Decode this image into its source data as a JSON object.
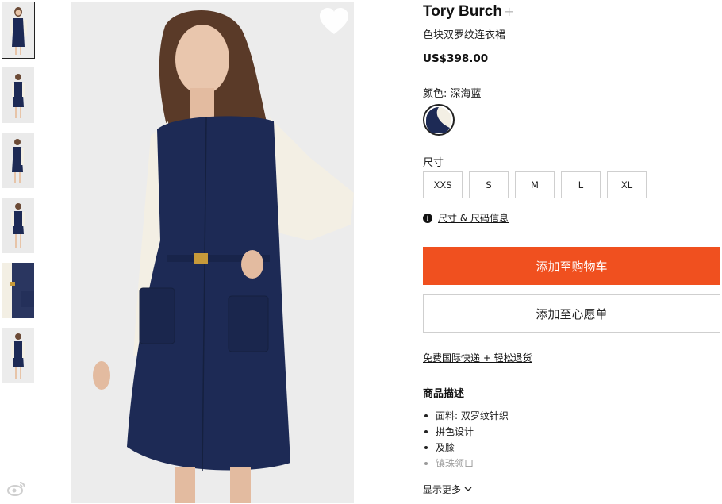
{
  "product": {
    "brand": "Tory Burch",
    "brand_plus": "+",
    "name": "色块双罗纹连衣裙",
    "price": "US$398.00"
  },
  "color": {
    "label": "颜色: 深海蓝",
    "swatch_colors": [
      "#1d2a55",
      "#f3efe4"
    ]
  },
  "size": {
    "label": "尺寸",
    "options": [
      "XXS",
      "S",
      "M",
      "L",
      "XL"
    ],
    "info_link": "尺寸 & 尺码信息"
  },
  "actions": {
    "add_to_cart": "添加至购物车",
    "add_to_wishlist": "添加至心愿单",
    "shipping": "免费国际快递 + 轻松退货"
  },
  "description": {
    "title": "商品描述",
    "bullets": [
      "面料: 双罗纹针织",
      "拼色设计",
      "及膝",
      "镶珠领口"
    ],
    "show_more": "显示更多"
  },
  "images": {
    "thumbnail_count": 6,
    "selected_thumbnail": 1
  },
  "icons": [
    "heart-icon",
    "info-icon",
    "chevron-down-icon",
    "weibo-icon"
  ],
  "colors": {
    "accent": "#f0501f",
    "dress_navy": "#1d2a55",
    "sleeve_ivory": "#f3efe4"
  }
}
